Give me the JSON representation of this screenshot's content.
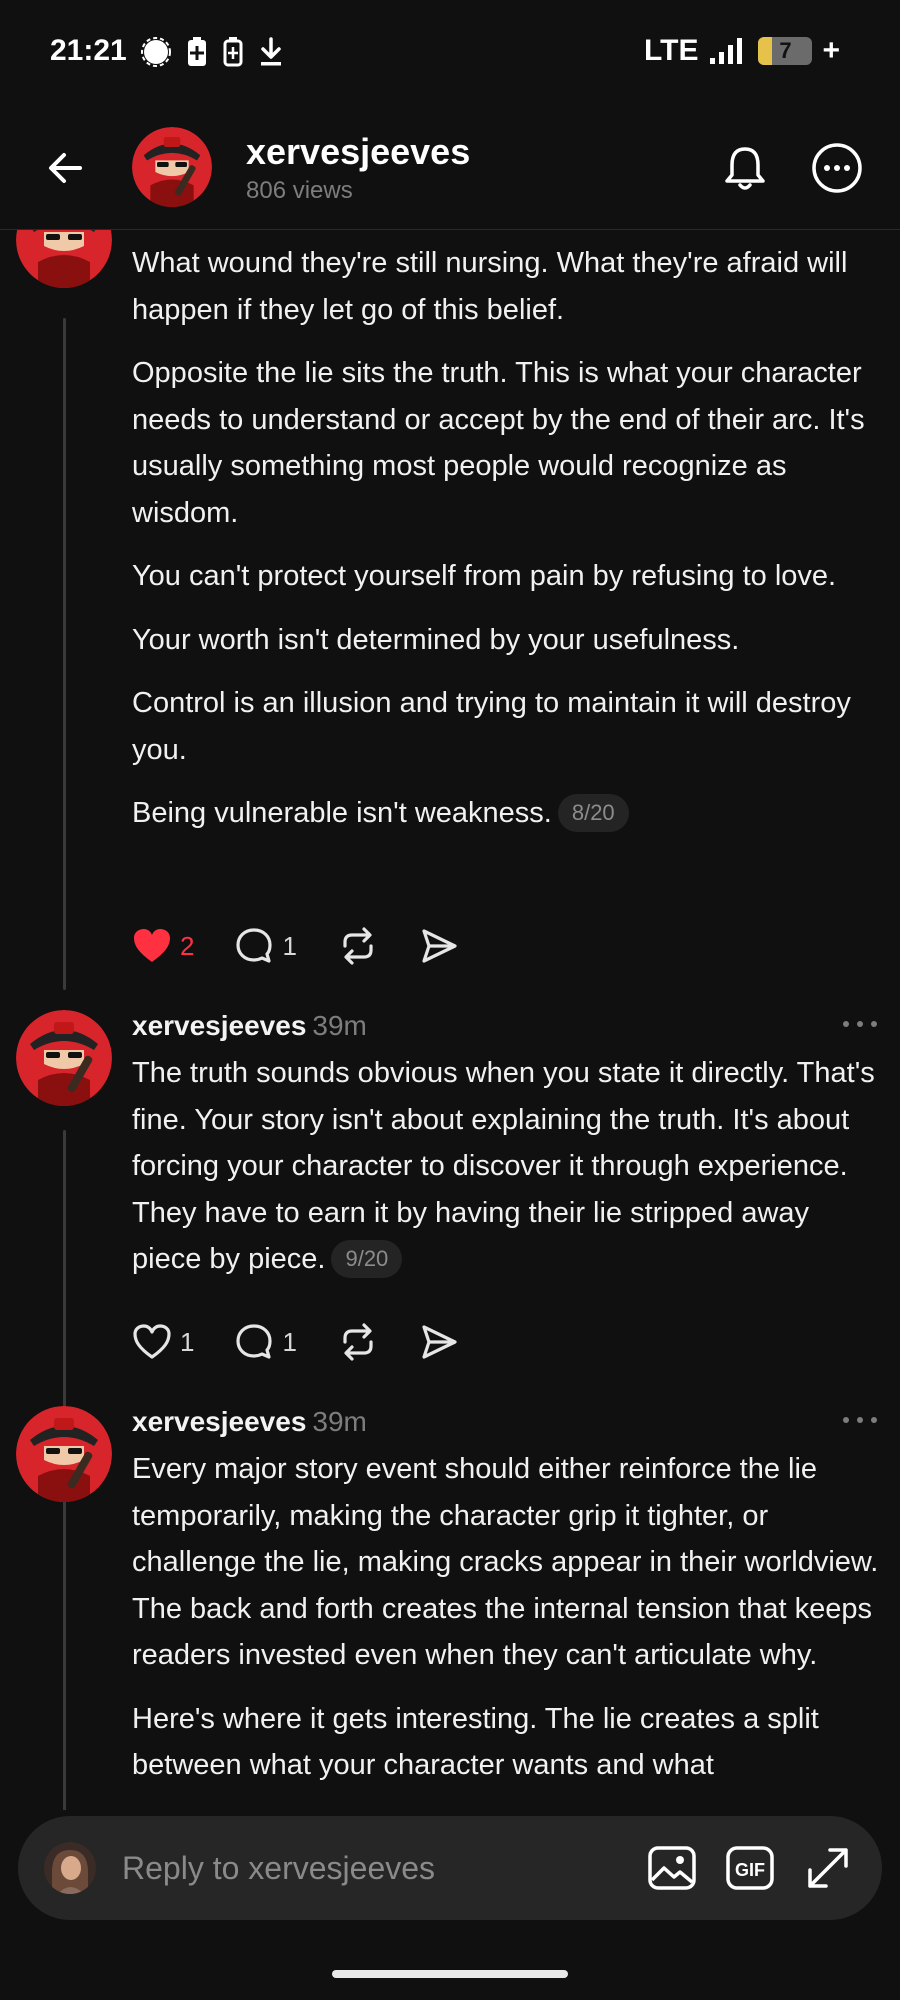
{
  "status_bar": {
    "time": "21:21",
    "network": "LTE",
    "battery_level": "7",
    "battery_fraction": 0.07,
    "left_icons": [
      "signal-app-icon",
      "battery-saver-icon",
      "battery-icon",
      "download-icon"
    ]
  },
  "header": {
    "title": "xervesjeeves",
    "views": "806 views"
  },
  "posts": [
    {
      "author": "xervesjeeves",
      "paragraphs": [
        "What wound they're still nursing. What they're afraid will happen if they let go of this belief.",
        "Opposite the lie sits the truth. This is what your character needs to understand or accept by the end of their arc. It's usually something most people would recognize as wisdom.",
        "You can't protect yourself from pain by refusing to love.",
        "Your worth isn't determined by your usefulness.",
        "Control is an illusion and trying to maintain it will destroy you.",
        "Being vulnerable isn't weakness."
      ],
      "page_counter": "8/20",
      "likes": "2",
      "liked": true,
      "comments": "1"
    },
    {
      "author": "xervesjeeves",
      "time": "39m",
      "paragraphs": [
        "The truth sounds obvious when you state it directly. That's fine. Your story isn't about explaining the truth. It's about forcing your character to discover it through experience. They have to earn it by having their lie stripped away piece by piece."
      ],
      "page_counter": "9/20",
      "likes": "1",
      "liked": false,
      "comments": "1"
    },
    {
      "author": "xervesjeeves",
      "time": "39m",
      "paragraphs": [
        "Every major story event should either reinforce the lie temporarily, making the character grip it tighter, or challenge the lie, making cracks appear in their worldview. The back and forth creates the internal tension that keeps readers invested even when they can't articulate why.",
        "Here's where it gets interesting. The lie creates a split between what your character wants and what"
      ]
    }
  ],
  "reply": {
    "placeholder": "Reply to xervesjeeves",
    "gif_label": "GIF"
  },
  "colors": {
    "background": "#101010",
    "text": "#f3f3f3",
    "muted": "#7d7d7d",
    "like_red": "#ff3040",
    "pill_bg": "#242424",
    "reply_bar_bg": "#262626"
  }
}
